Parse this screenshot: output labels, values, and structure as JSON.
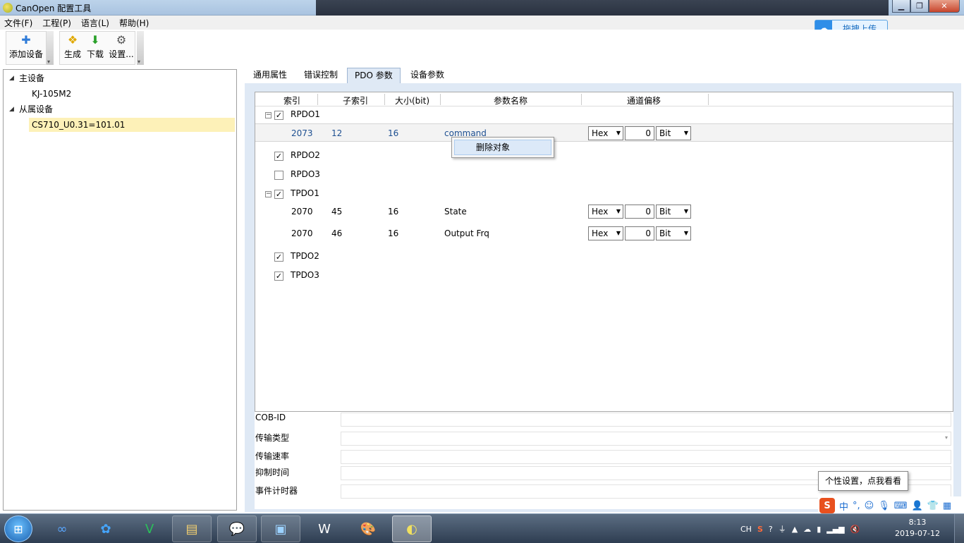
{
  "window": {
    "title": "CanOpen 配置工具"
  },
  "menu": [
    "文件(F)",
    "工程(P)",
    "语言(L)",
    "帮助(H)"
  ],
  "upload_button": "拖拽上传",
  "toolbar": {
    "add_device": "添加设备",
    "generate": "生成",
    "download": "下载",
    "settings": "设置..."
  },
  "tree": {
    "master_label": "主设备",
    "master_device": "KJ-105M2",
    "slave_label": "从属设备",
    "slave_device": "CS710_U0.31=101.01"
  },
  "tabs": [
    "通用属性",
    "错误控制",
    "PDO 参数",
    "设备参数"
  ],
  "active_tab": "PDO 参数",
  "grid": {
    "headers": [
      "索引",
      "子索引",
      "大小(bit)",
      "参数名称",
      "通道偏移"
    ],
    "rpdo1": {
      "label": "RPDO1",
      "checked": true
    },
    "rpdo1_row": {
      "index": "2073",
      "subindex": "12",
      "size": "16",
      "name": "command",
      "fmt": "Hex",
      "offset": "0",
      "unit": "Bit"
    },
    "rpdo2": {
      "label": "RPDO2",
      "checked": true
    },
    "rpdo3": {
      "label": "RPDO3",
      "checked": false
    },
    "tpdo1": {
      "label": "TPDO1",
      "checked": true
    },
    "tpdo1_rows": [
      {
        "index": "2070",
        "subindex": "45",
        "size": "16",
        "name": "State",
        "fmt": "Hex",
        "offset": "0",
        "unit": "Bit"
      },
      {
        "index": "2070",
        "subindex": "46",
        "size": "16",
        "name": "Output Frq",
        "fmt": "Hex",
        "offset": "0",
        "unit": "Bit"
      }
    ],
    "tpdo2": {
      "label": "TPDO2",
      "checked": true
    },
    "tpdo3": {
      "label": "TPDO3",
      "checked": true
    }
  },
  "context_menu": {
    "delete": "删除对象"
  },
  "properties": [
    "COB-ID",
    "传输类型",
    "传输速率",
    "抑制时间",
    "事件计时器"
  ],
  "tooltip": "个性设置，点我看看",
  "ime": {
    "lang": "中"
  },
  "tray": {
    "lang": "CH"
  },
  "clock": {
    "time": "8:13",
    "date": "2019-07-12"
  }
}
